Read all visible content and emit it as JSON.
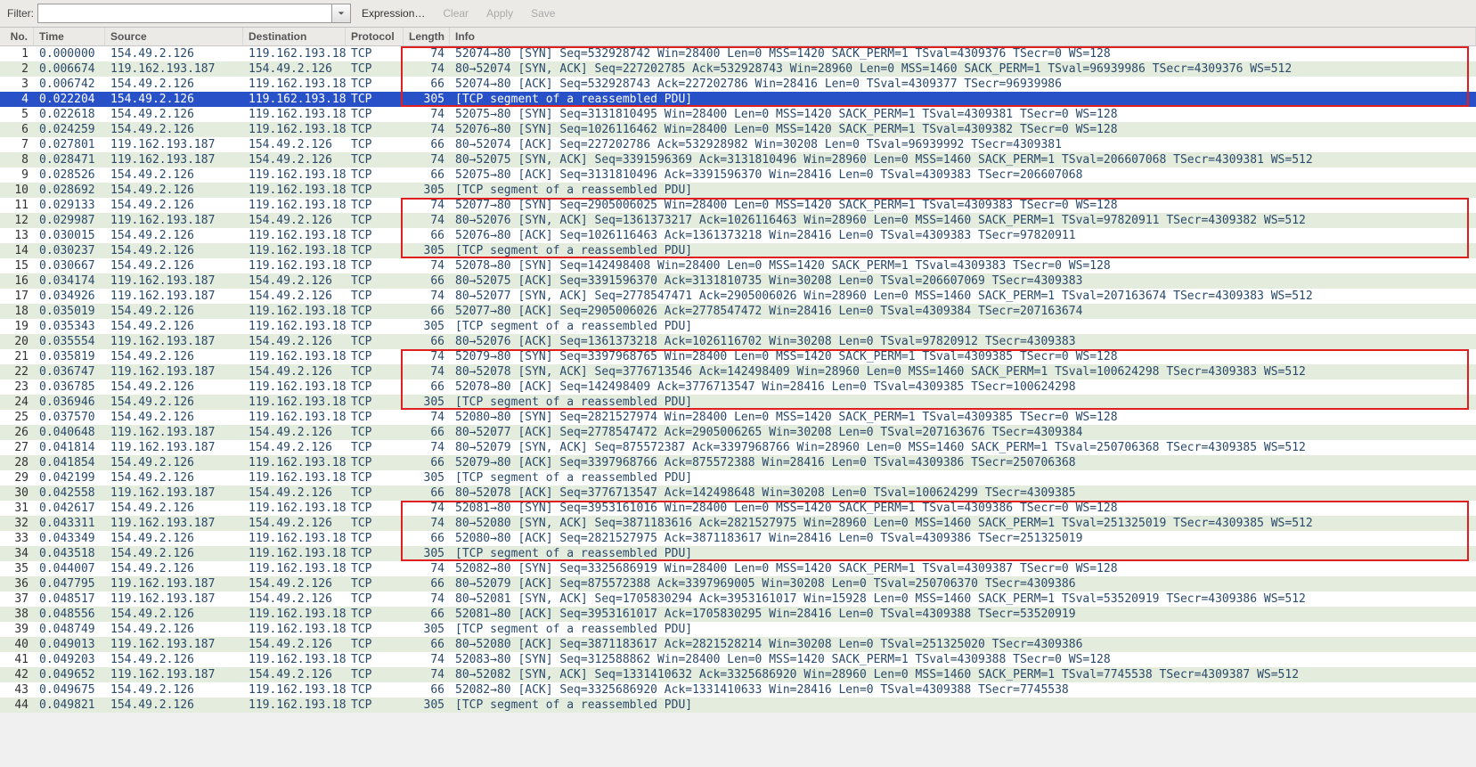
{
  "toolbar": {
    "filter_label": "Filter:",
    "filter_value": "",
    "expression": "Expression…",
    "clear": "Clear",
    "apply": "Apply",
    "save": "Save"
  },
  "columns": {
    "no": "No.",
    "time": "Time",
    "source": "Source",
    "destination": "Destination",
    "protocol": "Protocol",
    "length": "Length",
    "info": "Info"
  },
  "selected_row": 4,
  "highlights": [
    {
      "start": 1,
      "end": 4
    },
    {
      "start": 11,
      "end": 14
    },
    {
      "start": 21,
      "end": 24
    },
    {
      "start": 31,
      "end": 34
    }
  ],
  "packets": [
    {
      "no": 1,
      "time": "0.000000",
      "src": "154.49.2.126",
      "dst": "119.162.193.187",
      "proto": "TCP",
      "len": 74,
      "info": "52074→80 [SYN] Seq=532928742 Win=28400 Len=0 MSS=1420 SACK_PERM=1 TSval=4309376 TSecr=0 WS=128"
    },
    {
      "no": 2,
      "time": "0.006674",
      "src": "119.162.193.187",
      "dst": "154.49.2.126",
      "proto": "TCP",
      "len": 74,
      "info": "80→52074 [SYN, ACK] Seq=227202785 Ack=532928743 Win=28960 Len=0 MSS=1460 SACK_PERM=1 TSval=96939986 TSecr=4309376 WS=512"
    },
    {
      "no": 3,
      "time": "0.006742",
      "src": "154.49.2.126",
      "dst": "119.162.193.187",
      "proto": "TCP",
      "len": 66,
      "info": "52074→80 [ACK] Seq=532928743 Ack=227202786 Win=28416 Len=0 TSval=4309377 TSecr=96939986"
    },
    {
      "no": 4,
      "time": "0.022204",
      "src": "154.49.2.126",
      "dst": "119.162.193.187",
      "proto": "TCP",
      "len": 305,
      "info": "[TCP segment of a reassembled PDU]"
    },
    {
      "no": 5,
      "time": "0.022618",
      "src": "154.49.2.126",
      "dst": "119.162.193.187",
      "proto": "TCP",
      "len": 74,
      "info": "52075→80 [SYN] Seq=3131810495 Win=28400 Len=0 MSS=1420 SACK_PERM=1 TSval=4309381 TSecr=0 WS=128"
    },
    {
      "no": 6,
      "time": "0.024259",
      "src": "154.49.2.126",
      "dst": "119.162.193.187",
      "proto": "TCP",
      "len": 74,
      "info": "52076→80 [SYN] Seq=1026116462 Win=28400 Len=0 MSS=1420 SACK_PERM=1 TSval=4309382 TSecr=0 WS=128"
    },
    {
      "no": 7,
      "time": "0.027801",
      "src": "119.162.193.187",
      "dst": "154.49.2.126",
      "proto": "TCP",
      "len": 66,
      "info": "80→52074 [ACK] Seq=227202786 Ack=532928982 Win=30208 Len=0 TSval=96939992 TSecr=4309381"
    },
    {
      "no": 8,
      "time": "0.028471",
      "src": "119.162.193.187",
      "dst": "154.49.2.126",
      "proto": "TCP",
      "len": 74,
      "info": "80→52075 [SYN, ACK] Seq=3391596369 Ack=3131810496 Win=28960 Len=0 MSS=1460 SACK_PERM=1 TSval=206607068 TSecr=4309381 WS=512"
    },
    {
      "no": 9,
      "time": "0.028526",
      "src": "154.49.2.126",
      "dst": "119.162.193.187",
      "proto": "TCP",
      "len": 66,
      "info": "52075→80 [ACK] Seq=3131810496 Ack=3391596370 Win=28416 Len=0 TSval=4309383 TSecr=206607068"
    },
    {
      "no": 10,
      "time": "0.028692",
      "src": "154.49.2.126",
      "dst": "119.162.193.187",
      "proto": "TCP",
      "len": 305,
      "info": "[TCP segment of a reassembled PDU]"
    },
    {
      "no": 11,
      "time": "0.029133",
      "src": "154.49.2.126",
      "dst": "119.162.193.187",
      "proto": "TCP",
      "len": 74,
      "info": "52077→80 [SYN] Seq=2905006025 Win=28400 Len=0 MSS=1420 SACK_PERM=1 TSval=4309383 TSecr=0 WS=128"
    },
    {
      "no": 12,
      "time": "0.029987",
      "src": "119.162.193.187",
      "dst": "154.49.2.126",
      "proto": "TCP",
      "len": 74,
      "info": "80→52076 [SYN, ACK] Seq=1361373217 Ack=1026116463 Win=28960 Len=0 MSS=1460 SACK_PERM=1 TSval=97820911 TSecr=4309382 WS=512"
    },
    {
      "no": 13,
      "time": "0.030015",
      "src": "154.49.2.126",
      "dst": "119.162.193.187",
      "proto": "TCP",
      "len": 66,
      "info": "52076→80 [ACK] Seq=1026116463 Ack=1361373218 Win=28416 Len=0 TSval=4309383 TSecr=97820911"
    },
    {
      "no": 14,
      "time": "0.030237",
      "src": "154.49.2.126",
      "dst": "119.162.193.187",
      "proto": "TCP",
      "len": 305,
      "info": "[TCP segment of a reassembled PDU]"
    },
    {
      "no": 15,
      "time": "0.030667",
      "src": "154.49.2.126",
      "dst": "119.162.193.187",
      "proto": "TCP",
      "len": 74,
      "info": "52078→80 [SYN] Seq=142498408 Win=28400 Len=0 MSS=1420 SACK_PERM=1 TSval=4309383 TSecr=0 WS=128"
    },
    {
      "no": 16,
      "time": "0.034174",
      "src": "119.162.193.187",
      "dst": "154.49.2.126",
      "proto": "TCP",
      "len": 66,
      "info": "80→52075 [ACK] Seq=3391596370 Ack=3131810735 Win=30208 Len=0 TSval=206607069 TSecr=4309383"
    },
    {
      "no": 17,
      "time": "0.034926",
      "src": "119.162.193.187",
      "dst": "154.49.2.126",
      "proto": "TCP",
      "len": 74,
      "info": "80→52077 [SYN, ACK] Seq=2778547471 Ack=2905006026 Win=28960 Len=0 MSS=1460 SACK_PERM=1 TSval=207163674 TSecr=4309383 WS=512"
    },
    {
      "no": 18,
      "time": "0.035019",
      "src": "154.49.2.126",
      "dst": "119.162.193.187",
      "proto": "TCP",
      "len": 66,
      "info": "52077→80 [ACK] Seq=2905006026 Ack=2778547472 Win=28416 Len=0 TSval=4309384 TSecr=207163674"
    },
    {
      "no": 19,
      "time": "0.035343",
      "src": "154.49.2.126",
      "dst": "119.162.193.187",
      "proto": "TCP",
      "len": 305,
      "info": "[TCP segment of a reassembled PDU]"
    },
    {
      "no": 20,
      "time": "0.035554",
      "src": "119.162.193.187",
      "dst": "154.49.2.126",
      "proto": "TCP",
      "len": 66,
      "info": "80→52076 [ACK] Seq=1361373218 Ack=1026116702 Win=30208 Len=0 TSval=97820912 TSecr=4309383"
    },
    {
      "no": 21,
      "time": "0.035819",
      "src": "154.49.2.126",
      "dst": "119.162.193.187",
      "proto": "TCP",
      "len": 74,
      "info": "52079→80 [SYN] Seq=3397968765 Win=28400 Len=0 MSS=1420 SACK_PERM=1 TSval=4309385 TSecr=0 WS=128"
    },
    {
      "no": 22,
      "time": "0.036747",
      "src": "119.162.193.187",
      "dst": "154.49.2.126",
      "proto": "TCP",
      "len": 74,
      "info": "80→52078 [SYN, ACK] Seq=3776713546 Ack=142498409 Win=28960 Len=0 MSS=1460 SACK_PERM=1 TSval=100624298 TSecr=4309383 WS=512"
    },
    {
      "no": 23,
      "time": "0.036785",
      "src": "154.49.2.126",
      "dst": "119.162.193.187",
      "proto": "TCP",
      "len": 66,
      "info": "52078→80 [ACK] Seq=142498409 Ack=3776713547 Win=28416 Len=0 TSval=4309385 TSecr=100624298"
    },
    {
      "no": 24,
      "time": "0.036946",
      "src": "154.49.2.126",
      "dst": "119.162.193.187",
      "proto": "TCP",
      "len": 305,
      "info": "[TCP segment of a reassembled PDU]"
    },
    {
      "no": 25,
      "time": "0.037570",
      "src": "154.49.2.126",
      "dst": "119.162.193.187",
      "proto": "TCP",
      "len": 74,
      "info": "52080→80 [SYN] Seq=2821527974 Win=28400 Len=0 MSS=1420 SACK_PERM=1 TSval=4309385 TSecr=0 WS=128"
    },
    {
      "no": 26,
      "time": "0.040648",
      "src": "119.162.193.187",
      "dst": "154.49.2.126",
      "proto": "TCP",
      "len": 66,
      "info": "80→52077 [ACK] Seq=2778547472 Ack=2905006265 Win=30208 Len=0 TSval=207163676 TSecr=4309384"
    },
    {
      "no": 27,
      "time": "0.041814",
      "src": "119.162.193.187",
      "dst": "154.49.2.126",
      "proto": "TCP",
      "len": 74,
      "info": "80→52079 [SYN, ACK] Seq=875572387 Ack=3397968766 Win=28960 Len=0 MSS=1460 SACK_PERM=1 TSval=250706368 TSecr=4309385 WS=512"
    },
    {
      "no": 28,
      "time": "0.041854",
      "src": "154.49.2.126",
      "dst": "119.162.193.187",
      "proto": "TCP",
      "len": 66,
      "info": "52079→80 [ACK] Seq=3397968766 Ack=875572388 Win=28416 Len=0 TSval=4309386 TSecr=250706368"
    },
    {
      "no": 29,
      "time": "0.042199",
      "src": "154.49.2.126",
      "dst": "119.162.193.187",
      "proto": "TCP",
      "len": 305,
      "info": "[TCP segment of a reassembled PDU]"
    },
    {
      "no": 30,
      "time": "0.042558",
      "src": "119.162.193.187",
      "dst": "154.49.2.126",
      "proto": "TCP",
      "len": 66,
      "info": "80→52078 [ACK] Seq=3776713547 Ack=142498648 Win=30208 Len=0 TSval=100624299 TSecr=4309385"
    },
    {
      "no": 31,
      "time": "0.042617",
      "src": "154.49.2.126",
      "dst": "119.162.193.187",
      "proto": "TCP",
      "len": 74,
      "info": "52081→80 [SYN] Seq=3953161016 Win=28400 Len=0 MSS=1420 SACK_PERM=1 TSval=4309386 TSecr=0 WS=128"
    },
    {
      "no": 32,
      "time": "0.043311",
      "src": "119.162.193.187",
      "dst": "154.49.2.126",
      "proto": "TCP",
      "len": 74,
      "info": "80→52080 [SYN, ACK] Seq=3871183616 Ack=2821527975 Win=28960 Len=0 MSS=1460 SACK_PERM=1 TSval=251325019 TSecr=4309385 WS=512"
    },
    {
      "no": 33,
      "time": "0.043349",
      "src": "154.49.2.126",
      "dst": "119.162.193.187",
      "proto": "TCP",
      "len": 66,
      "info": "52080→80 [ACK] Seq=2821527975 Ack=3871183617 Win=28416 Len=0 TSval=4309386 TSecr=251325019"
    },
    {
      "no": 34,
      "time": "0.043518",
      "src": "154.49.2.126",
      "dst": "119.162.193.187",
      "proto": "TCP",
      "len": 305,
      "info": "[TCP segment of a reassembled PDU]"
    },
    {
      "no": 35,
      "time": "0.044007",
      "src": "154.49.2.126",
      "dst": "119.162.193.187",
      "proto": "TCP",
      "len": 74,
      "info": "52082→80 [SYN] Seq=3325686919 Win=28400 Len=0 MSS=1420 SACK_PERM=1 TSval=4309387 TSecr=0 WS=128"
    },
    {
      "no": 36,
      "time": "0.047795",
      "src": "119.162.193.187",
      "dst": "154.49.2.126",
      "proto": "TCP",
      "len": 66,
      "info": "80→52079 [ACK] Seq=875572388 Ack=3397969005 Win=30208 Len=0 TSval=250706370 TSecr=4309386"
    },
    {
      "no": 37,
      "time": "0.048517",
      "src": "119.162.193.187",
      "dst": "154.49.2.126",
      "proto": "TCP",
      "len": 74,
      "info": "80→52081 [SYN, ACK] Seq=1705830294 Ack=3953161017 Win=15928 Len=0 MSS=1460 SACK_PERM=1 TSval=53520919 TSecr=4309386 WS=512"
    },
    {
      "no": 38,
      "time": "0.048556",
      "src": "154.49.2.126",
      "dst": "119.162.193.187",
      "proto": "TCP",
      "len": 66,
      "info": "52081→80 [ACK] Seq=3953161017 Ack=1705830295 Win=28416 Len=0 TSval=4309388 TSecr=53520919"
    },
    {
      "no": 39,
      "time": "0.048749",
      "src": "154.49.2.126",
      "dst": "119.162.193.187",
      "proto": "TCP",
      "len": 305,
      "info": "[TCP segment of a reassembled PDU]"
    },
    {
      "no": 40,
      "time": "0.049013",
      "src": "119.162.193.187",
      "dst": "154.49.2.126",
      "proto": "TCP",
      "len": 66,
      "info": "80→52080 [ACK] Seq=3871183617 Ack=2821528214 Win=30208 Len=0 TSval=251325020 TSecr=4309386"
    },
    {
      "no": 41,
      "time": "0.049203",
      "src": "154.49.2.126",
      "dst": "119.162.193.187",
      "proto": "TCP",
      "len": 74,
      "info": "52083→80 [SYN] Seq=312588862 Win=28400 Len=0 MSS=1420 SACK_PERM=1 TSval=4309388 TSecr=0 WS=128"
    },
    {
      "no": 42,
      "time": "0.049652",
      "src": "119.162.193.187",
      "dst": "154.49.2.126",
      "proto": "TCP",
      "len": 74,
      "info": "80→52082 [SYN, ACK] Seq=1331410632 Ack=3325686920 Win=28960 Len=0 MSS=1460 SACK_PERM=1 TSval=7745538 TSecr=4309387 WS=512"
    },
    {
      "no": 43,
      "time": "0.049675",
      "src": "154.49.2.126",
      "dst": "119.162.193.187",
      "proto": "TCP",
      "len": 66,
      "info": "52082→80 [ACK] Seq=3325686920 Ack=1331410633 Win=28416 Len=0 TSval=4309388 TSecr=7745538"
    },
    {
      "no": 44,
      "time": "0.049821",
      "src": "154.49.2.126",
      "dst": "119.162.193.187",
      "proto": "TCP",
      "len": 305,
      "info": "[TCP segment of a reassembled PDU]"
    }
  ]
}
